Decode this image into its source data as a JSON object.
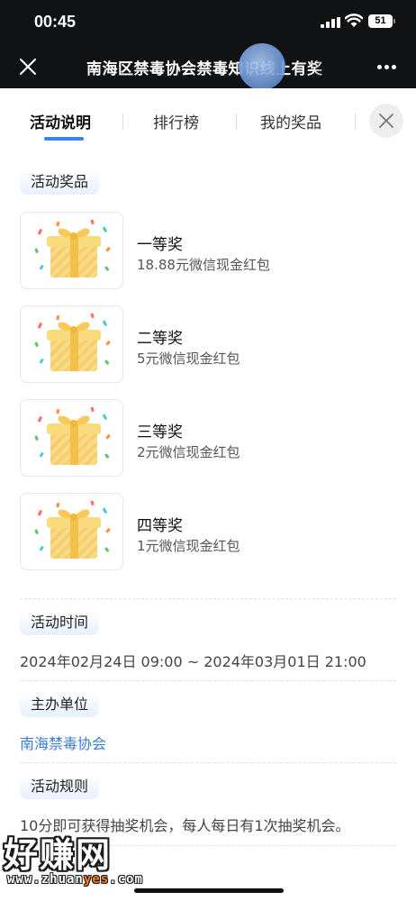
{
  "status_bar": {
    "time": "00:45",
    "battery": "51"
  },
  "title_bar": {
    "title": "南海区禁毒协会禁毒知识线上有奖"
  },
  "tabs": [
    {
      "label": "活动说明",
      "active": true
    },
    {
      "label": "排行榜",
      "active": false
    },
    {
      "label": "我的奖品",
      "active": false
    }
  ],
  "prizes_section": {
    "label": "活动奖品",
    "items": [
      {
        "name": "一等奖",
        "desc": "18.88元微信现金红包",
        "icon": "gift-box-icon"
      },
      {
        "name": "二等奖",
        "desc": "5元微信现金红包",
        "icon": "gift-box-icon"
      },
      {
        "name": "三等奖",
        "desc": "2元微信现金红包",
        "icon": "gift-box-icon"
      },
      {
        "name": "四等奖",
        "desc": "1元微信现金红包",
        "icon": "gift-box-icon"
      }
    ]
  },
  "time_section": {
    "label": "活动时间",
    "value": "2024年02月24日 09:00 ~ 2024年03月01日 21:00"
  },
  "organizer_section": {
    "label": "主办单位",
    "value": "南海禁毒协会"
  },
  "rules_section": {
    "label": "活动规则",
    "value": "10分即可获得抽奖机会，每人每日有1次抽奖机会。"
  },
  "watermark": {
    "main": "好赚网",
    "url_prefix": "www.zhuan",
    "url_highlight": "yes",
    "url_suffix": ".com"
  },
  "colors": {
    "accent": "#3b82f6",
    "link": "#3b7cd6",
    "topbar": "#111214"
  }
}
